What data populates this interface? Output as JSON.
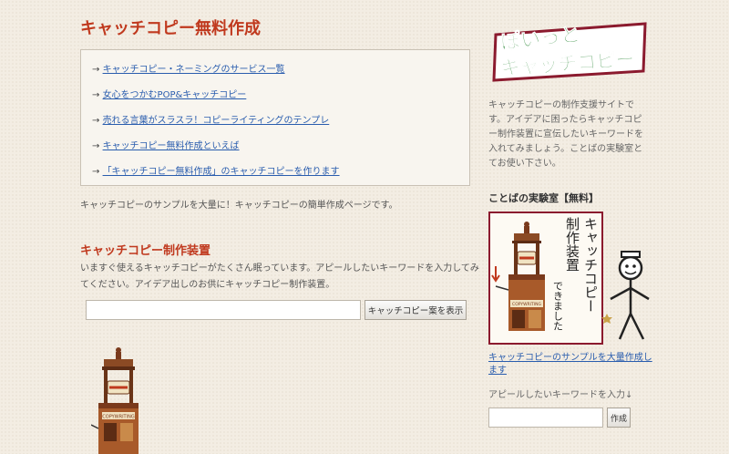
{
  "main": {
    "title": "キャッチコピー無料作成",
    "links": [
      {
        "arrow": "→ ",
        "label": "キャッチコピー・ネーミングのサービス一覧"
      },
      {
        "arrow": "→ ",
        "label": "女心をつかむPOP&キャッチコピー"
      },
      {
        "arrow": "→ ",
        "label": "売れる言葉がスラスラ！コピーライティングのテンプレ"
      },
      {
        "arrow": "→ ",
        "label": "キャッチコピー無料作成といえば"
      },
      {
        "arrow": "→ ",
        "label": "「キャッチコピー無料作成」のキャッチコピーを作ります"
      }
    ],
    "intro": "キャッチコピーのサンプルを大量に！キャッチコピーの簡単作成ページです。",
    "generator": {
      "title": "キャッチコピー制作装置",
      "description": "いますぐ使えるキャッチコピーがたくさん眠っています。アピールしたいキーワードを入力してみてください。アイデア出しのお供にキャッチコピー制作装置。",
      "input_value": "",
      "button_label": "キャッチコピー案を表示"
    },
    "machine_plate": "COPYWRITING"
  },
  "sidebar": {
    "logo": {
      "line1": "ぽいっと",
      "line2": "キャッチコピー"
    },
    "description": "キャッチコピーの制作支援サイトです。アイデアに困ったらキャッチコピー制作装置に宣伝したいキーワードを入れてみましょう。ことばの実験室とてお使い下さい。",
    "lab_title": "ことばの実験室【無料】",
    "banner": {
      "vertical_line1": "キャッチコピー",
      "vertical_line2": "制作装置",
      "vertical_line3": "できました",
      "plate": "COPYWRITING"
    },
    "sample_link": "キャッチコピーのサンプルを大量作成します",
    "hint": "アピールしたいキーワードを入力↓",
    "input_value": "",
    "button_label": "作成"
  },
  "colors": {
    "accent": "#c0391e",
    "link": "#2a5dae",
    "logo_green": "#2f8a3a",
    "logo_maroon": "#8b1a2e",
    "background": "#f3ede3"
  }
}
